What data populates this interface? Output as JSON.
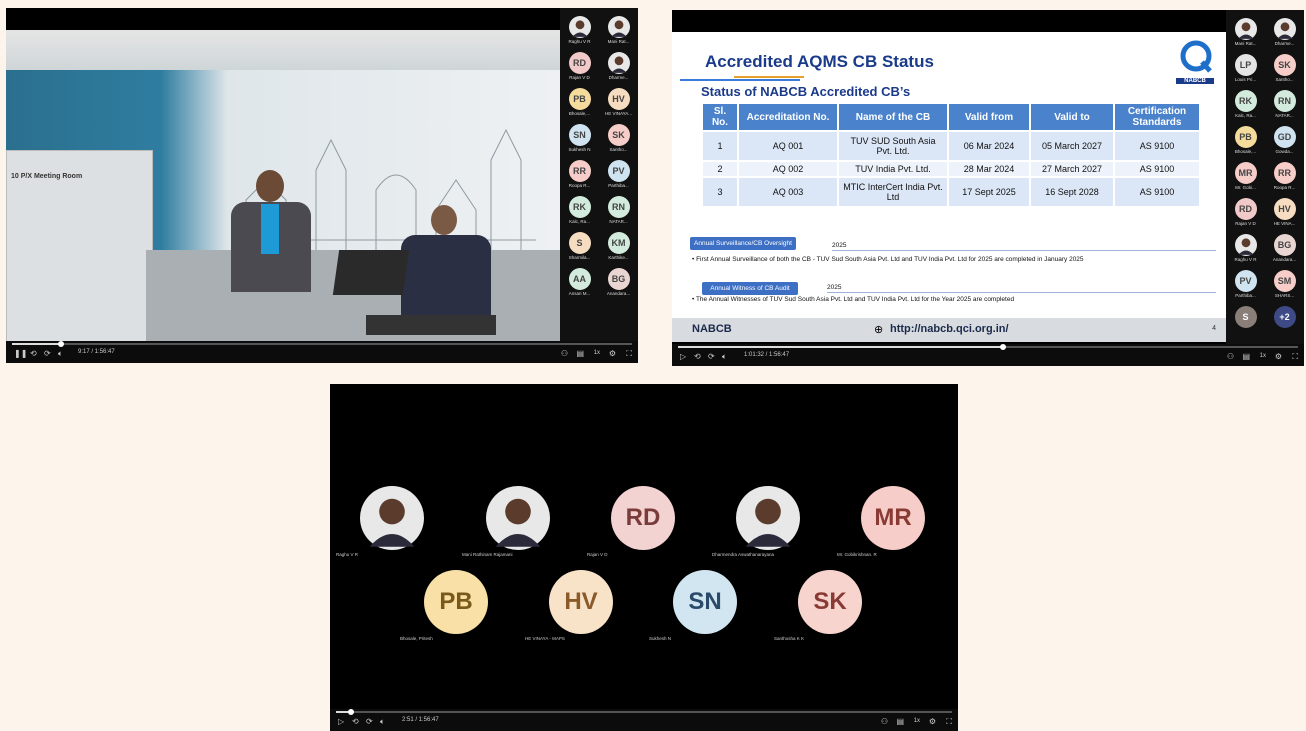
{
  "shot1": {
    "room_sign": "10 P/X Meeting Room",
    "time": "9:17 / 1:56:47",
    "speed": "1x",
    "progress": 0.079,
    "sidebar": [
      {
        "initials": "",
        "name": "Raghu V R",
        "photo": true
      },
      {
        "initials": "",
        "name": "Mani Rat...",
        "photo": true
      },
      {
        "initials": "RD",
        "name": "Rajan V D",
        "color": "#f2c9c9"
      },
      {
        "initials": "",
        "name": "Dharme...",
        "photo": true
      },
      {
        "initials": "PB",
        "name": "Bhosale,...",
        "color": "#f5dc9c"
      },
      {
        "initials": "HV",
        "name": "HE VINAYA...",
        "color": "#f6dcc0"
      },
      {
        "initials": "SN",
        "name": "Sukhesh N",
        "color": "#cfe4f0"
      },
      {
        "initials": "SK",
        "name": "Santho...",
        "color": "#f6cdc8"
      },
      {
        "initials": "RR",
        "name": "Roopa R...",
        "color": "#f6cdc8"
      },
      {
        "initials": "PV",
        "name": "Parthiba...",
        "color": "#cfe4f0"
      },
      {
        "initials": "RK",
        "name": "Kalc, Ra...",
        "color": "#d2ebdc"
      },
      {
        "initials": "RN",
        "name": "NATAR...",
        "color": "#d2ebdc"
      },
      {
        "initials": "S",
        "name": "Sharmila...",
        "color": "#f6dcc0"
      },
      {
        "initials": "KM",
        "name": "Karthike...",
        "color": "#d2ebdc"
      },
      {
        "initials": "AA",
        "name": "Ansari M...",
        "color": "#d2ebdc"
      },
      {
        "initials": "BG",
        "name": "Anandara...",
        "color": "#e9d6d2"
      }
    ]
  },
  "shot2": {
    "title": "Accredited AQMS CB Status",
    "subtitle": "Status of NABCB Accredited CB’s",
    "logo_label": "NABCB",
    "table_headers": [
      "Sl. No.",
      "Accreditation No.",
      "Name of the CB",
      "Valid from",
      "Valid to",
      "Certification Standards"
    ],
    "rows": [
      [
        "1",
        "AQ 001",
        "TUV SUD South Asia Pvt. Ltd.",
        "06 Mar 2024",
        "05 March 2027",
        "AS 9100"
      ],
      [
        "2",
        "AQ 002",
        "TUV India Pvt. Ltd.",
        "28 Mar 2024",
        "27 March 2027",
        "AS 9100"
      ],
      [
        "3",
        "AQ 003",
        "MTIC InterCert India Pvt. Ltd",
        "17 Sept 2025",
        "16 Sept 2028",
        "AS 9100"
      ]
    ],
    "section1_label": "Annual Surveillance/CB Oversight",
    "section1_year": "2025",
    "section1_text": "• First Annual Surveillance of both the CB - TUV Sud South Asia Pvt. Ltd and TUV India Pvt. Ltd for 2025 are completed in January 2025",
    "section2_label": "Annual Witness of CB Audit",
    "section2_year": "2025",
    "section2_text": "• The Annual Witnesses of TUV Sud South Asia Pvt. Ltd and TUV India Pvt. Ltd for the Year 2025 are completed",
    "footer_left": "NABCB",
    "footer_url": "http://nabcb.qci.org.in/",
    "page_number": "4",
    "time": "1:01:32 / 1:56:47",
    "speed": "1x",
    "progress": 0.524,
    "sidebar": [
      {
        "initials": "",
        "name": "Mani Rat...",
        "photo": true
      },
      {
        "initials": "",
        "name": "Dharme...",
        "photo": true
      },
      {
        "initials": "LP",
        "name": "Louis Pri...",
        "color": "#e5e5e5"
      },
      {
        "initials": "SK",
        "name": "Santho...",
        "color": "#f6cdc8"
      },
      {
        "initials": "RK",
        "name": "Kalc, Ra...",
        "color": "#d2ebdc"
      },
      {
        "initials": "RN",
        "name": "NATAR...",
        "color": "#d2ebdc"
      },
      {
        "initials": "PB",
        "name": "Bhosale,...",
        "color": "#f5dc9c"
      },
      {
        "initials": "GD",
        "name": "Gowda...",
        "color": "#cfe4f0"
      },
      {
        "initials": "MR",
        "name": "Mr. Gobi...",
        "color": "#f6cdc8"
      },
      {
        "initials": "RR",
        "name": "Roopa R...",
        "color": "#f6cdc8"
      },
      {
        "initials": "RD",
        "name": "Rajan V D",
        "color": "#f2c9c9"
      },
      {
        "initials": "HV",
        "name": "HE VINA...",
        "color": "#f6dcc0"
      },
      {
        "initials": "",
        "name": "Raghu V R",
        "photo": true
      },
      {
        "initials": "BG",
        "name": "Anandara...",
        "color": "#e9d6d2"
      },
      {
        "initials": "PV",
        "name": "Parthiba...",
        "color": "#cfe4f0"
      },
      {
        "initials": "SM",
        "name": "SHARS...",
        "color": "#f6cdc8"
      },
      {
        "initials": "S",
        "name": "",
        "color": "#8a7f78"
      },
      {
        "initials": "+2",
        "name": "",
        "color": "#3d4a86"
      }
    ]
  },
  "shot3": {
    "time": "2:51 / 1:56:47",
    "speed": "1x",
    "progress": 0.024,
    "participants": [
      {
        "initials": "",
        "name": "Raghu V R",
        "photo": true
      },
      {
        "initials": "",
        "name": "Mani Rathinam Rajamani",
        "photo": true
      },
      {
        "initials": "RD",
        "name": "Rajan V D",
        "color": "#f3d2d2",
        "text": "#7a3b3b"
      },
      {
        "initials": "",
        "name": "Dharmendra Aswathanarayana",
        "photo": true
      },
      {
        "initials": "MR",
        "name": "Mr. Gobikrishnan. R",
        "color": "#f6cdc8",
        "text": "#8a3a35"
      },
      {
        "initials": "PB",
        "name": "Bhosale, Pritesh",
        "color": "#f8e0a6",
        "text": "#7a5a1a"
      },
      {
        "initials": "HV",
        "name": "HE VINAYA - MAPS",
        "color": "#f8e2c8",
        "text": "#8a5a2a"
      },
      {
        "initials": "SN",
        "name": "Sukhesh N",
        "color": "#d2e6f2",
        "text": "#2a4a6a"
      },
      {
        "initials": "SK",
        "name": "Santhosha K K",
        "color": "#f8d4cf",
        "text": "#8a3a35"
      }
    ]
  }
}
